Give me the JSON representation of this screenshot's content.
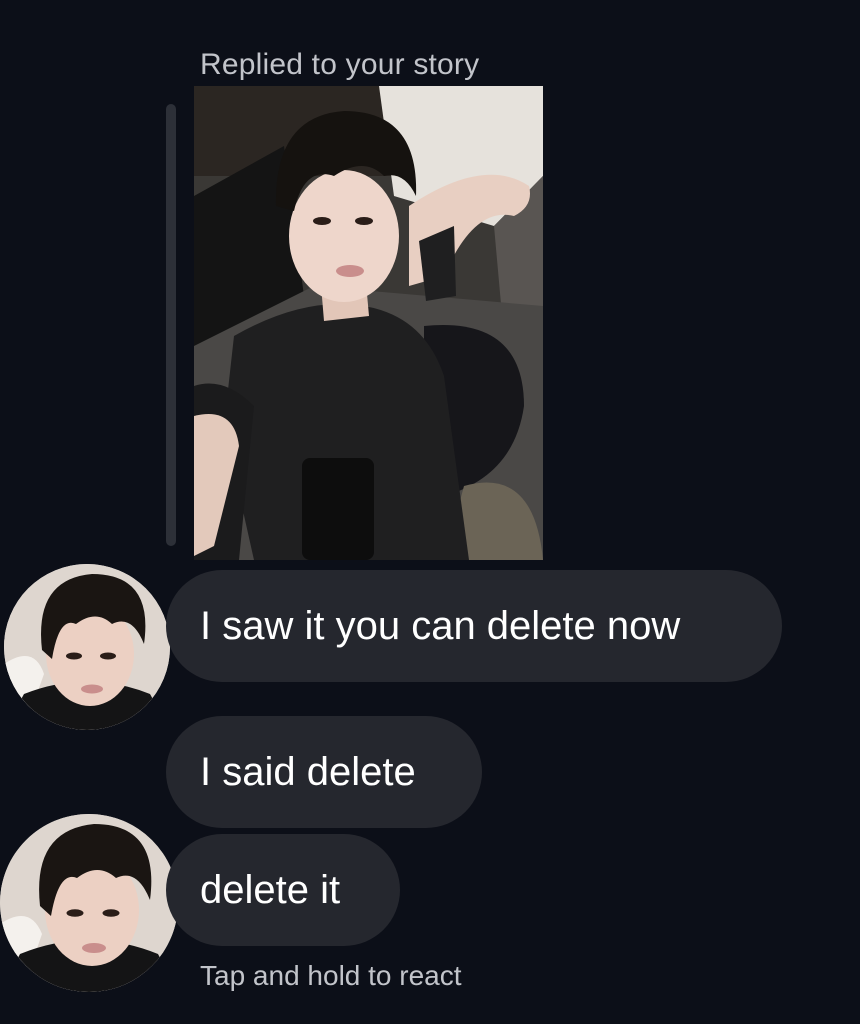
{
  "thread": {
    "reply_label": "Replied to your story",
    "story": {
      "icon": "story-photo",
      "interactable": true
    },
    "messages": [
      {
        "text": "I saw it you can delete now",
        "avatar": "contact-avatar"
      },
      {
        "text": "I said delete",
        "avatar": ""
      },
      {
        "text": "delete it",
        "avatar": "contact-avatar"
      }
    ],
    "hint": "Tap and hold to react"
  },
  "colors": {
    "background": "#0c0f18",
    "bubble": "#25272e",
    "secondary_text": "#c2c4ca"
  }
}
